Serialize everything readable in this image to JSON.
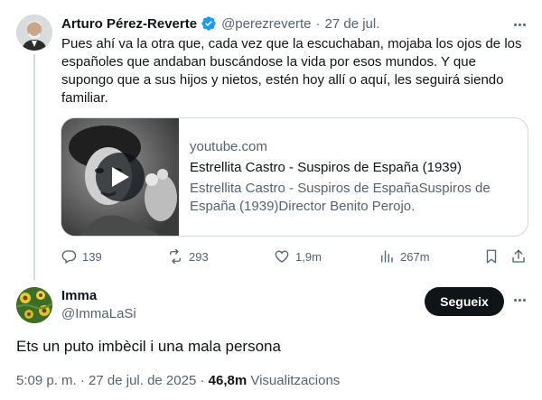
{
  "tweet": {
    "author_name": "Arturo Pérez-Reverte",
    "handle": "@perezreverte",
    "separator": "·",
    "date": "27 de jul.",
    "text": "Pues ahí va la otra que, cada vez que la escuchaban, mojaba los ojos de los\nespañoles que andaban buscándose la vida por esos mundos. Y que\nsupongo que a sus hijos y nietos, estén hoy allí o aquí, les seguirá siendo\nfamiliar.",
    "verified_color": "#1d9bf0",
    "card": {
      "domain": "youtube.com",
      "title": "Estrellita Castro - Suspiros de España (1939)",
      "description": "Estrellita Castro - Suspiros de EspañaSuspiros de España (1939)Director Benito Perojo."
    },
    "actions": {
      "replies": "139",
      "retweets": "293",
      "likes": "1,9m",
      "views": "267m"
    }
  },
  "reply": {
    "author_name": "Imma",
    "handle": "@ImmaLaSi",
    "follow_label": "Segueix",
    "text": "Ets un puto imbècil i una mala persona",
    "timestamp": "5:09 p. m. · 27 de jul. de 2025 ·",
    "views_count": "46,8m",
    "views_label": "Visualitzacions"
  },
  "icons": {
    "reply": "reply-icon",
    "retweet": "retweet-icon",
    "like": "heart-icon",
    "views": "views-icon",
    "bookmark": "bookmark-icon",
    "share": "share-icon",
    "more": "more-icon",
    "verified": "verified-badge-icon",
    "play": "play-icon"
  }
}
